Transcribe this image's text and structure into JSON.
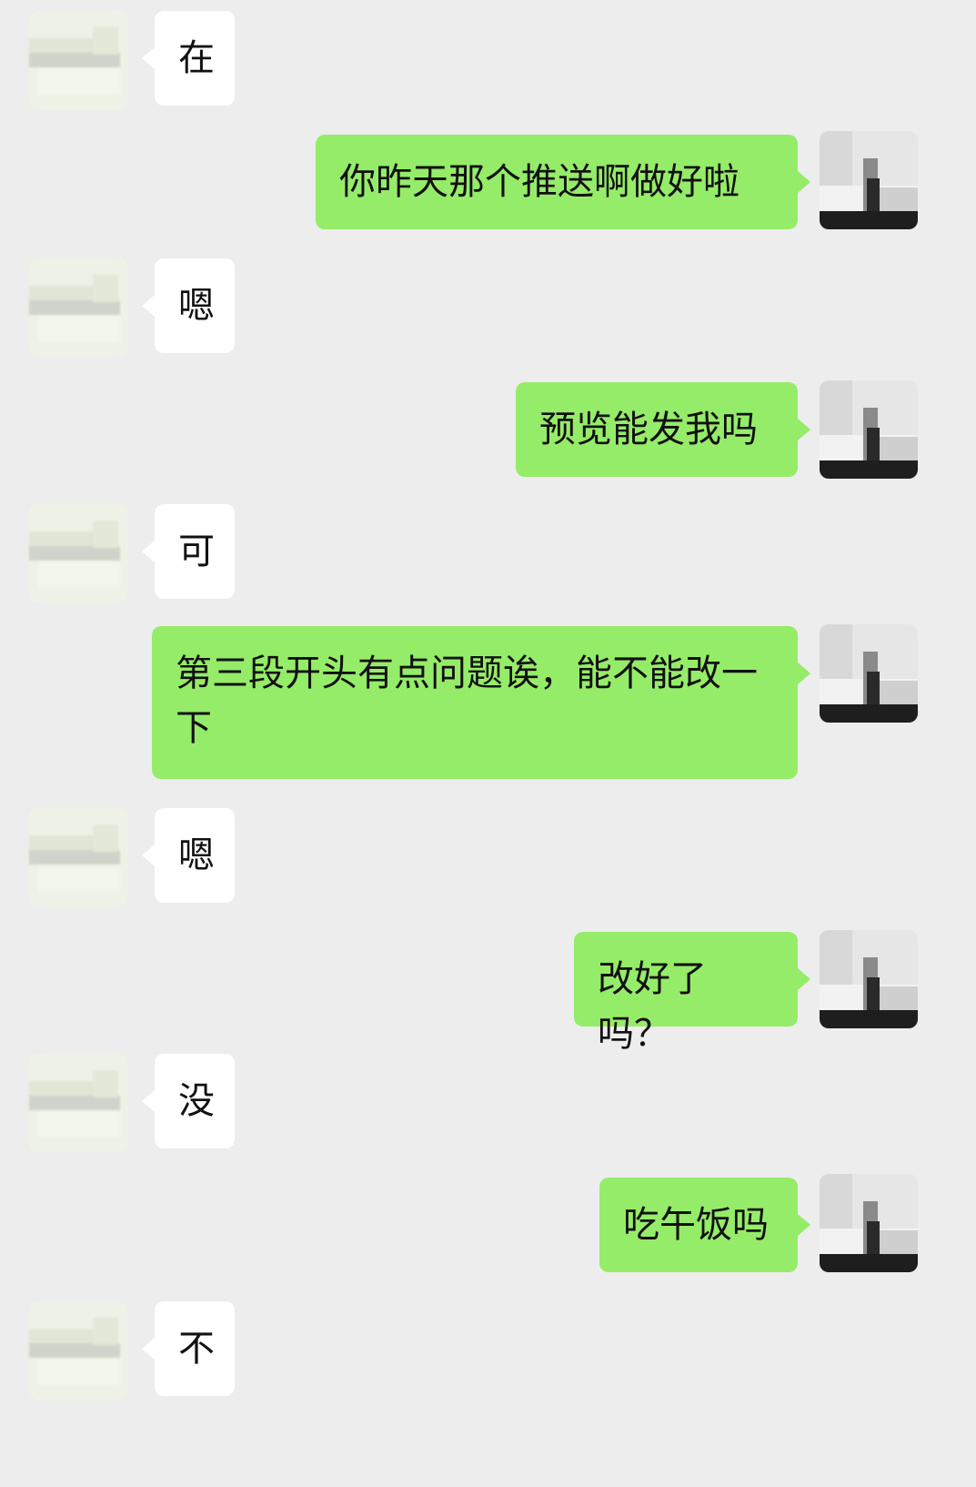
{
  "messages": [
    {
      "side": "in",
      "text": "在"
    },
    {
      "side": "out",
      "text": "你昨天那个推送啊做好啦"
    },
    {
      "side": "in",
      "text": "嗯"
    },
    {
      "side": "out",
      "text": "预览能发我吗"
    },
    {
      "side": "in",
      "text": "可"
    },
    {
      "side": "out",
      "text": "第三段开头有点问题诶，能不能改一下"
    },
    {
      "side": "in",
      "text": "嗯"
    },
    {
      "side": "out",
      "text": "改好了吗？"
    },
    {
      "side": "in",
      "text": "没"
    },
    {
      "side": "out",
      "text": "吃午饭吗"
    },
    {
      "side": "in",
      "text": "不"
    }
  ],
  "colors": {
    "background": "#ededed",
    "incoming_bubble": "#ffffff",
    "outgoing_bubble": "#95ec69"
  }
}
